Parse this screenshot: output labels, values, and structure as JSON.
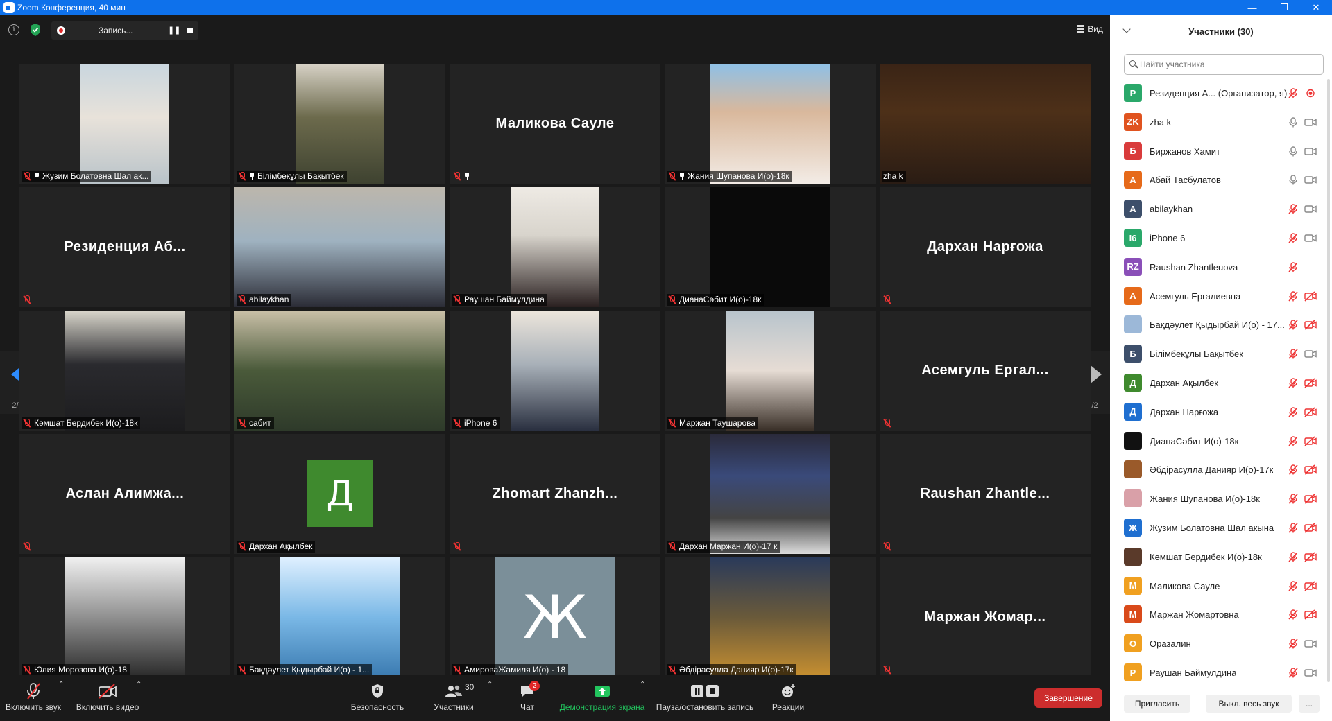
{
  "window": {
    "title": "Zoom Конференция, 40 мин"
  },
  "topbar": {
    "record_label": "Запись...",
    "view_label": "Вид"
  },
  "gallery": {
    "page_indicator_left": "2/2",
    "page_indicator_right": "2/2",
    "tiles": [
      {
        "name": "Жузим Болатовна Шал ак...",
        "kind": "video",
        "pinned": true
      },
      {
        "name": "Білімбекұлы Бақытбек",
        "kind": "video",
        "pinned": true
      },
      {
        "name": "Маликова Сауле",
        "kind": "name",
        "pinned": true
      },
      {
        "name": "Жания Шупанова И(о)-18к",
        "kind": "video",
        "pinned": true
      },
      {
        "name": "zha k",
        "kind": "video",
        "active": true
      },
      {
        "name": "Резиденция Аб...",
        "kind": "name"
      },
      {
        "name": "abilaykhan",
        "kind": "video"
      },
      {
        "name": "Раушан Баймулдина",
        "kind": "video"
      },
      {
        "name": "ДианаСәбит И(о)-18к",
        "kind": "video"
      },
      {
        "name": "Дархан Нарғожа",
        "kind": "name"
      },
      {
        "name": "Кәмшат Бердибек И(о)-18к",
        "kind": "video"
      },
      {
        "name": "сабит",
        "kind": "video"
      },
      {
        "name": "iPhone 6",
        "kind": "video"
      },
      {
        "name": "Маржан Таушарова",
        "kind": "video"
      },
      {
        "name": "Асемгуль Ергал...",
        "kind": "name"
      },
      {
        "name": "Аслан Алимжа...",
        "kind": "name"
      },
      {
        "name": "Дархан Ақылбек",
        "kind": "avatar",
        "letter": "Д",
        "color": "#3f8a2e"
      },
      {
        "name": "Zhomart Zhanzh...",
        "kind": "name"
      },
      {
        "name": "Дархан Маржан И(о)-17 к",
        "kind": "video"
      },
      {
        "name": "Raushan Zhantle...",
        "kind": "name"
      },
      {
        "name": "Юлия Морозова И(о)-18",
        "kind": "video"
      },
      {
        "name": "Бақдәулет Қыдырбай И(о) - 1...",
        "kind": "video"
      },
      {
        "name": "АмироваЖамиля И(о) - 18",
        "kind": "avatar",
        "letter": "Ж",
        "color": "#7b8f99"
      },
      {
        "name": "Әбдірасулла Данияр И(о)-17к",
        "kind": "video"
      },
      {
        "name": "Маржан Жомар...",
        "kind": "name"
      }
    ]
  },
  "toolbar": {
    "unmute_label": "Включить звук",
    "start_video_label": "Включить видео",
    "security_label": "Безопасность",
    "participants_label": "Участники",
    "participants_count": "30",
    "chat_label": "Чат",
    "chat_badge": "2",
    "share_label": "Демонстрация экрана",
    "pause_rec_label": "Пауза/остановить запись",
    "reactions_label": "Реакции",
    "end_label": "Завершение"
  },
  "panel": {
    "title": "Участники (30)",
    "search_placeholder": "Найти участника",
    "participants": [
      {
        "initials": "Р",
        "color": "#2aa86a",
        "name": "Резиденция А... (Организатор, я)",
        "mic": "off",
        "cam": "rec"
      },
      {
        "initials": "ZK",
        "color": "#e0531f",
        "name": "zha k",
        "mic": "on",
        "cam": "on"
      },
      {
        "initials": "Б",
        "color": "#d93b3b",
        "name": "Биржанов Хамит",
        "mic": "on",
        "cam": "on"
      },
      {
        "initials": "А",
        "color": "#e66a1a",
        "name": "Абай Тасбулатов",
        "mic": "on",
        "cam": "on"
      },
      {
        "initials": "A",
        "color": "#3d4f6b",
        "name": "abilaykhan",
        "mic": "off",
        "cam": "on"
      },
      {
        "initials": "I6",
        "color": "#2aa86a",
        "name": "iPhone 6",
        "mic": "off",
        "cam": "on"
      },
      {
        "initials": "RZ",
        "color": "#8a4fb8",
        "name": "Raushan Zhantleuova",
        "mic": "off",
        "cam": "none"
      },
      {
        "initials": "А",
        "color": "#e66a1a",
        "name": "Асемгуль Ергалиевна",
        "mic": "off",
        "cam": "off"
      },
      {
        "initials": "",
        "color": "#9cb8d8",
        "name": "Бақдәулет Қыдырбай И(о) - 17...",
        "mic": "off",
        "cam": "off"
      },
      {
        "initials": "Б",
        "color": "#3d4f6b",
        "name": "Білімбекұлы Бақытбек",
        "mic": "off",
        "cam": "on"
      },
      {
        "initials": "Д",
        "color": "#3f8a2e",
        "name": "Дархан Ақылбек",
        "mic": "off",
        "cam": "off"
      },
      {
        "initials": "Д",
        "color": "#1f6fd0",
        "name": "Дархан Нарғожа",
        "mic": "off",
        "cam": "off"
      },
      {
        "initials": "",
        "color": "#111111",
        "name": "ДианаСәбит И(о)-18к",
        "mic": "off",
        "cam": "off"
      },
      {
        "initials": "",
        "color": "#9a5a2a",
        "name": "Әбдірасулла Данияр И(о)-17к",
        "mic": "off",
        "cam": "off"
      },
      {
        "initials": "",
        "color": "#d9a0a8",
        "name": "Жания Шупанова И(о)-18к",
        "mic": "off",
        "cam": "off"
      },
      {
        "initials": "Ж",
        "color": "#1f6fd0",
        "name": "Жузим Болатовна Шал акына",
        "mic": "off",
        "cam": "off"
      },
      {
        "initials": "",
        "color": "#5a3a2a",
        "name": "Кәмшат Бердибек И(о)-18к",
        "mic": "off",
        "cam": "off"
      },
      {
        "initials": "М",
        "color": "#f0a020",
        "name": "Маликова Сауле",
        "mic": "off",
        "cam": "off"
      },
      {
        "initials": "М",
        "color": "#d94a1a",
        "name": "Маржан Жомартовна",
        "mic": "off",
        "cam": "off"
      },
      {
        "initials": "О",
        "color": "#f0a020",
        "name": "Оразалин",
        "mic": "off",
        "cam": "on"
      },
      {
        "initials": "Р",
        "color": "#f0a020",
        "name": "Раушан Баймулдина",
        "mic": "off",
        "cam": "on"
      }
    ],
    "invite_label": "Пригласить",
    "mute_all_label": "Выкл. весь звук",
    "more_label": "..."
  },
  "colors": {
    "titlebar": "#0e71eb",
    "active_speaker": "#f1e65b",
    "end_button": "#cc2d2d",
    "share_green": "#22c55e"
  }
}
